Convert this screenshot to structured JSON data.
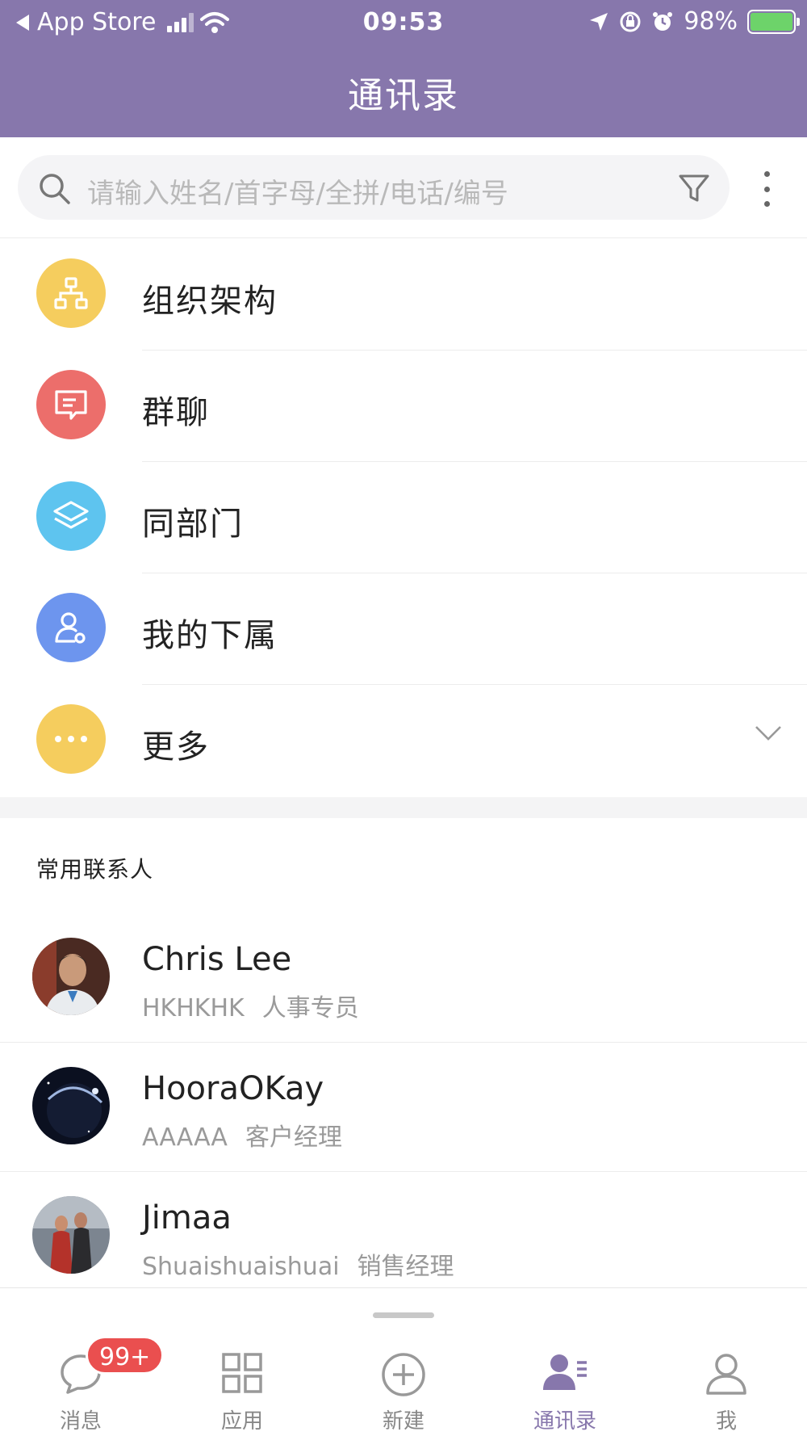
{
  "status_bar": {
    "back_app": "App Store",
    "time": "09:53",
    "battery": "98%"
  },
  "header": {
    "title": "通讯录"
  },
  "search": {
    "placeholder": "请输入姓名/首字母/全拼/电话/编号"
  },
  "menu": {
    "items": [
      {
        "label": "组织架构",
        "icon": "org-chart-icon",
        "color": "#f5cd5e"
      },
      {
        "label": "群聊",
        "icon": "chat-icon",
        "color": "#ec6e6b"
      },
      {
        "label": "同部门",
        "icon": "layers-icon",
        "color": "#5ec4ef"
      },
      {
        "label": "我的下属",
        "icon": "subordinate-icon",
        "color": "#6d95ee"
      },
      {
        "label": "更多",
        "icon": "more-dots-icon",
        "color": "#f5cd5e"
      }
    ]
  },
  "frequent": {
    "title": "常用联系人",
    "contacts": [
      {
        "name": "Chris Lee",
        "dept": "HKHKHK",
        "role": "人事专员"
      },
      {
        "name": "HooraOKay",
        "dept": "AAAAA",
        "role": "客户经理"
      },
      {
        "name": "Jimaa",
        "dept": "Shuaishuaishuai",
        "role": "销售经理"
      }
    ]
  },
  "tabbar": {
    "badge": "99+",
    "tabs": [
      {
        "label": "消息",
        "icon": "message-icon"
      },
      {
        "label": "应用",
        "icon": "apps-grid-icon"
      },
      {
        "label": "新建",
        "icon": "add-circle-icon"
      },
      {
        "label": "通讯录",
        "icon": "contacts-icon",
        "active": true
      },
      {
        "label": "我",
        "icon": "person-icon"
      }
    ]
  },
  "colors": {
    "primary": "#8777ac",
    "badge": "#ea4f4f"
  }
}
